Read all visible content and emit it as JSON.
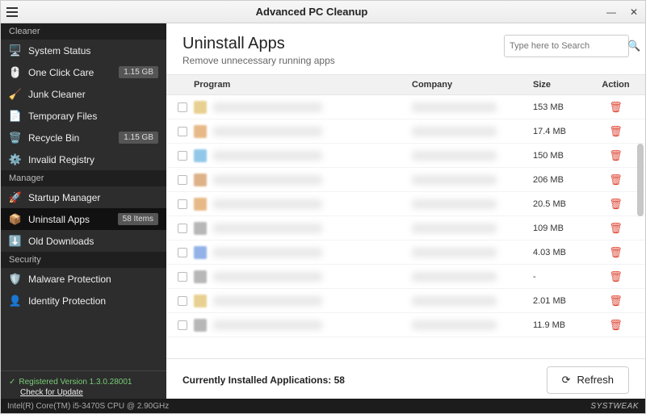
{
  "window": {
    "title": "Advanced PC Cleanup"
  },
  "sidebar": {
    "sections": {
      "cleaner": "Cleaner",
      "manager": "Manager",
      "security": "Security"
    },
    "items": {
      "system_status": {
        "label": "System Status",
        "badge": ""
      },
      "one_click": {
        "label": "One Click Care",
        "badge": "1.15 GB"
      },
      "junk": {
        "label": "Junk Cleaner",
        "badge": ""
      },
      "temp": {
        "label": "Temporary Files",
        "badge": ""
      },
      "recycle": {
        "label": "Recycle Bin",
        "badge": "1.15 GB"
      },
      "registry": {
        "label": "Invalid Registry",
        "badge": ""
      },
      "startup": {
        "label": "Startup Manager",
        "badge": ""
      },
      "uninstall": {
        "label": "Uninstall Apps",
        "badge": "58 Items"
      },
      "downloads": {
        "label": "Old Downloads",
        "badge": ""
      },
      "malware": {
        "label": "Malware Protection",
        "badge": ""
      },
      "identity": {
        "label": "Identity Protection",
        "badge": ""
      }
    },
    "footer": {
      "registered": "Registered Version 1.3.0.28001",
      "check_update": "Check for Update"
    }
  },
  "main": {
    "title": "Uninstall Apps",
    "subtitle": "Remove unnecessary running apps",
    "search_placeholder": "Type here to Search",
    "columns": {
      "program": "Program",
      "company": "Company",
      "size": "Size",
      "action": "Action"
    },
    "rows": [
      {
        "size": "153 MB",
        "icon": "#d9b24a"
      },
      {
        "size": "17.4 MB",
        "icon": "#d98c3a"
      },
      {
        "size": "150 MB",
        "icon": "#4aa3d9"
      },
      {
        "size": "206 MB",
        "icon": "#c97f3a"
      },
      {
        "size": "20.5 MB",
        "icon": "#d98c3a"
      },
      {
        "size": "109 MB",
        "icon": "#888888"
      },
      {
        "size": "4.03 MB",
        "icon": "#4a7fd9"
      },
      {
        "size": "-",
        "icon": "#888888"
      },
      {
        "size": "2.01 MB",
        "icon": "#d9b24a"
      },
      {
        "size": "11.9 MB",
        "icon": "#888888"
      }
    ],
    "footer_count_label": "Currently Installed Applications:",
    "footer_count_value": "58",
    "refresh_label": "Refresh"
  },
  "statusbar": {
    "cpu": "Intel(R) Core(TM) i5-3470S CPU @ 2.90GHz",
    "watermark": "SYSTWEAK"
  }
}
